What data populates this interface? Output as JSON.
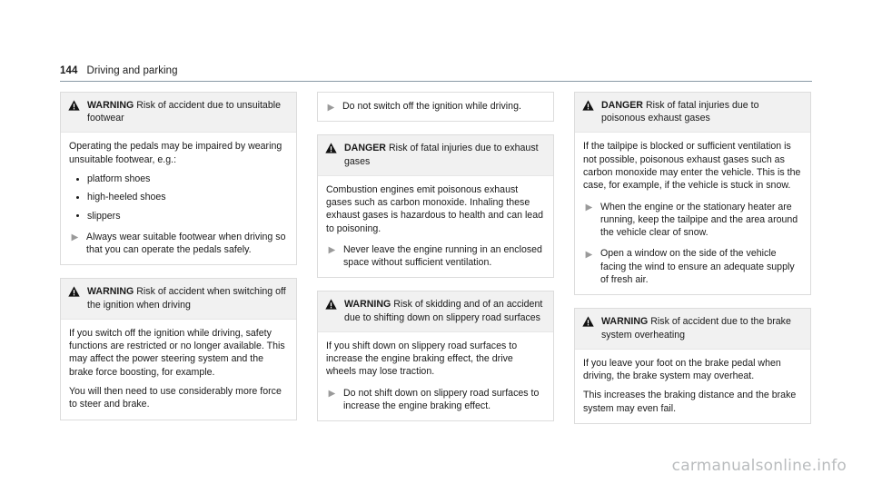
{
  "header": {
    "page_number": "144",
    "chapter": "Driving and parking"
  },
  "icons": {
    "warning_triangle": "warning-triangle-icon",
    "action_arrow": "action-arrow-icon"
  },
  "colors": {
    "box_border": "#dcdcdc",
    "box_header_bg": "#f1f1f1",
    "rule": "#8a9aa5",
    "text": "#1a1a1a",
    "arrow": "#9a9a9a",
    "watermark": "#b9bcbe"
  },
  "column1": {
    "box1": {
      "label": "WARNING",
      "title": "Risk of accident due to unsuitable footwear",
      "para1": "Operating the pedals may be impaired by wearing unsuitable footwear, e.g.:",
      "bullets": [
        "platform shoes",
        "high-heeled shoes",
        "slippers"
      ],
      "action1": "Always wear suitable footwear when driving so that you can operate the pedals safely."
    },
    "box2": {
      "label": "WARNING",
      "title": "Risk of accident when switching off the ignition when driving",
      "para1": "If you switch off the ignition while driving, safety functions are restricted or no longer available. This may affect the power steering system and the brake force boosting, for example.",
      "para2": "You will then need to use considerably more force to steer and brake."
    }
  },
  "column2": {
    "free1": {
      "action1": "Do not switch off the ignition while driving."
    },
    "box1": {
      "label": "DANGER",
      "title": "Risk of fatal injuries due to exhaust gases",
      "para1": "Combustion engines emit poisonous exhaust gases such as carbon monoxide. Inhaling these exhaust gases is hazardous to health and can lead to poisoning.",
      "action1": "Never leave the engine running in an enclosed space without sufficient ventilation."
    },
    "box2": {
      "label": "WARNING",
      "title": "Risk of skidding and of an accident due to shifting down on slippery road surfaces",
      "para1": "If you shift down on slippery road surfaces to increase the engine braking effect, the drive wheels may lose traction.",
      "action1": "Do not shift down on slippery road surfaces to increase the engine braking effect."
    }
  },
  "column3": {
    "box1": {
      "label": "DANGER",
      "title": "Risk of fatal injuries due to poisonous exhaust gases",
      "para1": "If the tailpipe is blocked or sufficient ventilation is not possible, poisonous exhaust gases such as carbon monoxide may enter the vehicle. This is the case, for example, if the vehicle is stuck in snow.",
      "action1": "When the engine or the stationary heater are running, keep the tailpipe and the area around the vehicle clear of snow.",
      "action2": "Open a window on the side of the vehicle facing the wind to ensure an adequate supply of fresh air."
    },
    "box2": {
      "label": "WARNING",
      "title": "Risk of accident due to the brake system overheating",
      "para1": "If you leave your foot on the brake pedal when driving, the brake system may overheat.",
      "para2": "This increases the braking distance and the brake system may even fail."
    }
  },
  "watermark": {
    "text": "carmanualsonline.info"
  }
}
